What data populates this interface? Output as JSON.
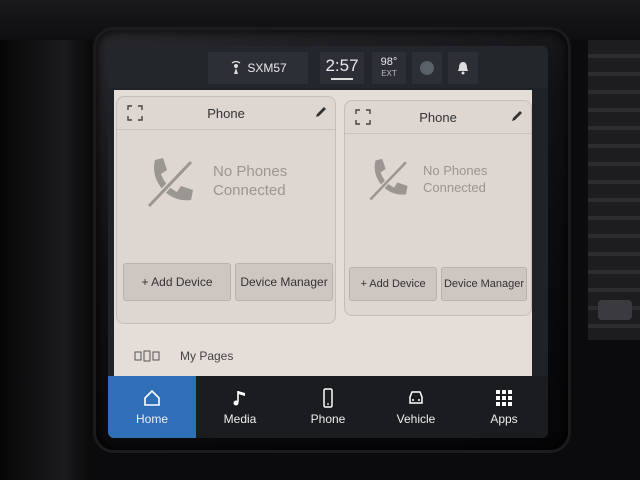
{
  "status_bar": {
    "radio": "SXM57",
    "time": "2:57",
    "temperature": "98°",
    "temperature_sub": "EXT"
  },
  "cards": [
    {
      "title": "Phone",
      "status_line1": "No Phones",
      "status_line2": "Connected",
      "add_device": "+ Add Device",
      "device_manager": "Device Manager"
    },
    {
      "title": "Phone",
      "status_line1": "No Phones",
      "status_line2": "Connected",
      "add_device": "+ Add Device",
      "device_manager": "Device Manager"
    }
  ],
  "my_pages": "My Pages",
  "nav": [
    {
      "label": "Home",
      "icon": "home-icon",
      "active": true
    },
    {
      "label": "Media",
      "icon": "music-note-icon",
      "active": false
    },
    {
      "label": "Phone",
      "icon": "phone-icon",
      "active": false
    },
    {
      "label": "Vehicle",
      "icon": "car-icon",
      "active": false
    },
    {
      "label": "Apps",
      "icon": "apps-grid-icon",
      "active": false
    }
  ],
  "colors": {
    "accent": "#2f6fb7",
    "panel": "#e4ddd8"
  }
}
